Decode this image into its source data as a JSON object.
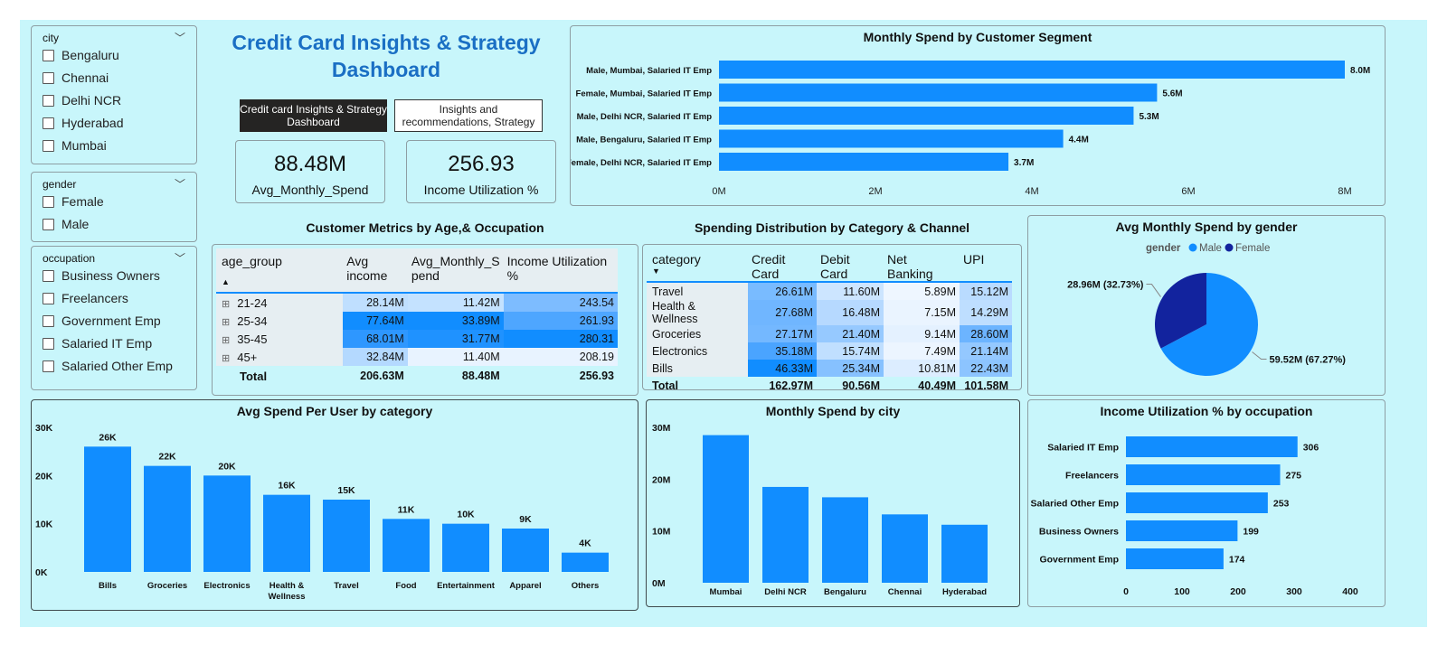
{
  "header": {
    "title_line1": "Credit Card Insights & Strategy",
    "title_line2": "Dashboard"
  },
  "nav": {
    "btn_dashboard": "Credit card Insights & Strategy Dashboard",
    "btn_insights": "Insights and recommendations, Strategy"
  },
  "kpis": [
    {
      "value": "88.48M",
      "label": "Avg_Monthly_Spend"
    },
    {
      "value": "256.93",
      "label": "Income Utilization %"
    }
  ],
  "slicers": {
    "city": {
      "title": "city",
      "items": [
        "Bengaluru",
        "Chennai",
        "Delhi NCR",
        "Hyderabad",
        "Mumbai"
      ]
    },
    "gender": {
      "title": "gender",
      "items": [
        "Female",
        "Male"
      ]
    },
    "occupation": {
      "title": "occupation",
      "items": [
        "Business Owners",
        "Freelancers",
        "Government Emp",
        "Salaried IT Emp",
        "Salaried Other Emp"
      ]
    }
  },
  "age_table": {
    "title": "Customer Metrics by Age,& Occupation",
    "headers": [
      "age_group",
      "Avg income",
      "Avg_Monthly_Spend",
      "Income Utilization %"
    ],
    "header_lines": [
      [
        "age_group"
      ],
      [
        "Avg",
        "income"
      ],
      [
        "Avg_Monthly_S",
        "pend"
      ],
      [
        "Income Utilization",
        "%"
      ]
    ],
    "rows": [
      {
        "group": "21-24",
        "income": "28.14M",
        "spend": "11.42M",
        "util": "243.54"
      },
      {
        "group": "25-34",
        "income": "77.64M",
        "spend": "33.89M",
        "util": "261.93"
      },
      {
        "group": "35-45",
        "income": "68.01M",
        "spend": "31.77M",
        "util": "280.31"
      },
      {
        "group": "45+",
        "income": "32.84M",
        "spend": "11.40M",
        "util": "208.19"
      }
    ],
    "total": {
      "label": "Total",
      "income": "206.63M",
      "spend": "88.48M",
      "util": "256.93"
    }
  },
  "category_table": {
    "title": "Spending Distribution by Category & Channel",
    "headers": [
      "category",
      "Credit Card",
      "Debit Card",
      "Net Banking",
      "UPI"
    ],
    "rows": [
      [
        "Travel",
        "26.61M",
        "11.60M",
        "5.89M",
        "15.12M"
      ],
      [
        "Health & Wellness",
        "27.68M",
        "16.48M",
        "7.15M",
        "14.29M"
      ],
      [
        "Groceries",
        "27.17M",
        "21.40M",
        "9.14M",
        "28.60M"
      ],
      [
        "Electronics",
        "35.18M",
        "15.74M",
        "7.49M",
        "21.14M"
      ],
      [
        "Bills",
        "46.33M",
        "25.34M",
        "10.81M",
        "22.43M"
      ]
    ],
    "total": [
      "Total",
      "162.97M",
      "90.56M",
      "40.49M",
      "101.58M"
    ]
  },
  "colors": {
    "accent": "#118dff",
    "dark_blue": "#12239e",
    "background": "#c8f6fb",
    "title_blue": "#1a6fc4"
  },
  "chart_data": [
    {
      "id": "segment",
      "type": "bar",
      "orientation": "horizontal",
      "title": "Monthly Spend by Customer Segment",
      "categories": [
        "Male, Mumbai, Salaried IT Emp",
        "Female, Mumbai, Salaried IT Emp",
        "Male, Delhi NCR, Salaried IT Emp",
        "Male, Bengaluru, Salaried IT Emp",
        "Female, Delhi NCR, Salaried IT Emp"
      ],
      "values": [
        8.0,
        5.6,
        5.3,
        4.4,
        3.7
      ],
      "data_labels": [
        "8.0M",
        "5.6M",
        "5.3M",
        "4.4M",
        "3.7M"
      ],
      "ticks": [
        "0M",
        "2M",
        "4M",
        "6M",
        "8M"
      ],
      "xlim": [
        0,
        8
      ]
    },
    {
      "id": "gender",
      "type": "pie",
      "title": "Avg Monthly Spend by gender",
      "legend_title": "gender",
      "legend_position": "top",
      "series": [
        {
          "name": "Male",
          "value": 59.52,
          "label": "59.52M (67.27%)"
        },
        {
          "name": "Female",
          "value": 28.96,
          "label": "28.96M (32.73%)"
        }
      ]
    },
    {
      "id": "category",
      "type": "bar",
      "title": "Avg Spend Per User by category",
      "categories": [
        "Bills",
        "Groceries",
        "Electronics",
        "Health & Wellness",
        "Travel",
        "Food",
        "Entertainment",
        "Apparel",
        "Others"
      ],
      "values": [
        26,
        22,
        20,
        16,
        15,
        11,
        10,
        9,
        4
      ],
      "data_labels": [
        "26K",
        "22K",
        "20K",
        "16K",
        "15K",
        "11K",
        "10K",
        "9K",
        "4K"
      ],
      "ticks": [
        "0K",
        "10K",
        "20K",
        "30K"
      ],
      "ylim": [
        0,
        30
      ]
    },
    {
      "id": "city",
      "type": "bar",
      "title": "Monthly Spend by city",
      "categories": [
        "Mumbai",
        "Delhi NCR",
        "Bengaluru",
        "Chennai",
        "Hyderabad"
      ],
      "values": [
        28.5,
        18.5,
        16.5,
        13.2,
        11.2
      ],
      "ticks": [
        "0M",
        "10M",
        "20M",
        "30M"
      ],
      "ylim": [
        0,
        30
      ]
    },
    {
      "id": "occupation",
      "type": "bar",
      "orientation": "horizontal",
      "title": "Income Utilization % by occupation",
      "categories": [
        "Salaried IT Emp",
        "Freelancers",
        "Salaried Other Emp",
        "Business Owners",
        "Government Emp"
      ],
      "values": [
        306,
        275,
        253,
        199,
        174
      ],
      "data_labels": [
        "306",
        "275",
        "253",
        "199",
        "174"
      ],
      "ticks": [
        "0",
        "100",
        "200",
        "300",
        "400"
      ],
      "xlim": [
        0,
        400
      ]
    }
  ]
}
